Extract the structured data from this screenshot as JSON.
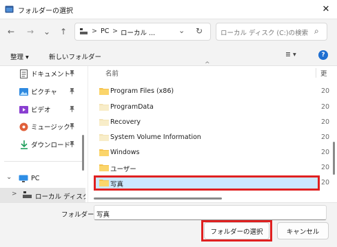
{
  "window": {
    "title": "フォルダーの選択",
    "close_glyph": "✕"
  },
  "nav": {
    "back_glyph": "←",
    "forward_glyph": "→",
    "recent_glyph": "⌄",
    "up_glyph": "↑",
    "breadcrumb_separator": ">",
    "breadcrumb": [
      "PC",
      "ローカル ..."
    ],
    "refresh_glyph": "↻",
    "search_placeholder": "ローカル ディスク (C:)の検索",
    "search_glyph": "⌕"
  },
  "toolbar": {
    "organize_label": "整理 ▾",
    "new_folder_label": "新しいフォルダー",
    "view_glyph": "≣ ▾",
    "help_glyph": "?"
  },
  "sidebar": {
    "items": [
      {
        "label": "ドキュメント",
        "icon": "documents-icon",
        "pinned": true
      },
      {
        "label": "ピクチャ",
        "icon": "pictures-icon",
        "pinned": true
      },
      {
        "label": "ビデオ",
        "icon": "videos-icon",
        "pinned": true
      },
      {
        "label": "ミュージック",
        "icon": "music-icon",
        "pinned": true
      },
      {
        "label": "ダウンロード",
        "icon": "downloads-icon",
        "pinned": true
      }
    ],
    "pin_glyph": "📌",
    "pc_label": "PC",
    "pc_chevron": "⌄",
    "local_disk_label": "ローカル ディスク",
    "local_disk_chevron": ">"
  },
  "file_list": {
    "header_name": "名前",
    "header_next": "更",
    "sort_glyph": "^",
    "rows": [
      {
        "name": "Program Files (x86)",
        "extra": "20",
        "selected": false
      },
      {
        "name": "ProgramData",
        "extra": "20",
        "selected": false
      },
      {
        "name": "Recovery",
        "extra": "20",
        "selected": false
      },
      {
        "name": "System Volume Information",
        "extra": "20",
        "selected": false
      },
      {
        "name": "Windows",
        "extra": "20",
        "selected": false
      },
      {
        "name": "ユーザー",
        "extra": "20",
        "selected": false
      },
      {
        "name": "写真",
        "extra": "20",
        "selected": true
      }
    ]
  },
  "footer": {
    "folder_label": "フォルダー:",
    "folder_value": "写真",
    "select_button": "フォルダーの選択",
    "cancel_button": "キャンセル"
  },
  "colors": {
    "accent": "#005fb8",
    "highlight_border": "#e02020",
    "selected_row": "#cce8ff",
    "folder": "#f5c24d"
  }
}
